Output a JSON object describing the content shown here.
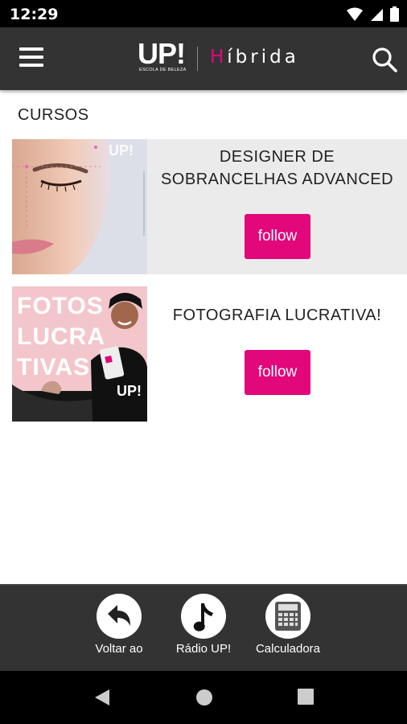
{
  "status_bar": {
    "time": "12:29"
  },
  "app_bar": {
    "logo_main": "UP!",
    "logo_sub": "ESCOLA DE BELEZA",
    "logo_product_initial": "H",
    "logo_product_rest": "íbrida",
    "accent_color": "#e2077a"
  },
  "section": {
    "title": "CURSOS"
  },
  "courses": [
    {
      "title_line1": "DESIGNER DE",
      "title_line2": "SOBRANCELHAS ADVANCED",
      "follow_label": "follow",
      "thumb_watermark": "UP!"
    },
    {
      "title_line1": "FOTOGRAFIA LUCRATIVA!",
      "follow_label": "follow",
      "thumb_text": [
        "FOTOS",
        "LUCRA",
        "TIVAS"
      ],
      "thumb_watermark": "UP!"
    }
  ],
  "bottom_nav": [
    {
      "label": "Voltar ao",
      "icon": "back-arrow-icon"
    },
    {
      "label": "Rádio UP!",
      "icon": "music-note-icon"
    },
    {
      "label": "Calculadora",
      "icon": "calculator-icon"
    }
  ]
}
